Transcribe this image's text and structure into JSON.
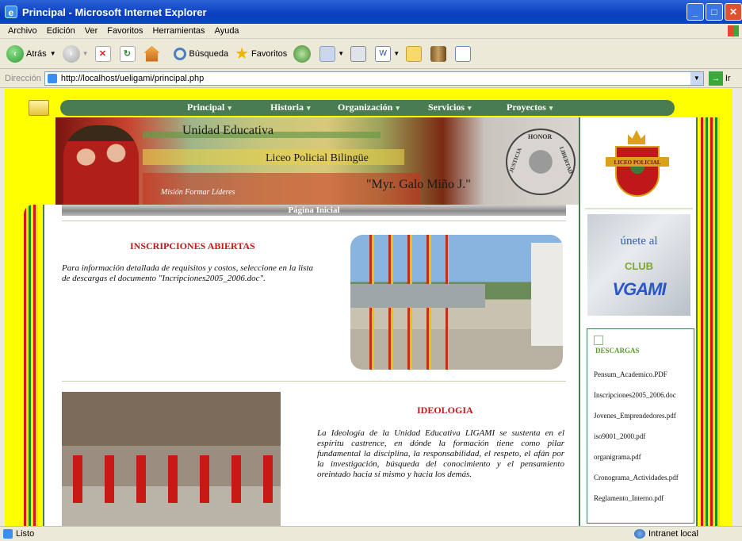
{
  "window": {
    "title": "Principal - Microsoft Internet Explorer"
  },
  "menu": [
    "Archivo",
    "Edición",
    "Ver",
    "Favoritos",
    "Herramientas",
    "Ayuda"
  ],
  "toolbar": {
    "back": "Atrás",
    "search": "Búsqueda",
    "favorites": "Favoritos"
  },
  "address": {
    "label": "Dirección",
    "url": "http://localhost/ueligami/principal.php",
    "go": "Ir"
  },
  "nav": [
    {
      "label": "Principal"
    },
    {
      "label": "Historia"
    },
    {
      "label": "Organización"
    },
    {
      "label": "Servicios"
    },
    {
      "label": "Proyectos"
    }
  ],
  "banner": {
    "line1": "Unidad Educativa",
    "line2": "Liceo Policial Bilingüe",
    "line3": "\"Myr. Galo Miño J.\"",
    "motto": "Misión Formar Líderes",
    "seal_top": "HONOR",
    "seal_left": "JUSTICIA",
    "seal_right": "LIBERTAD"
  },
  "logo": {
    "text": "LICEO POLICIAL"
  },
  "club": {
    "line1": "únete al",
    "line2": "CLUB",
    "line3": "VGAMI"
  },
  "page_header": "Página Inicial",
  "inscripciones": {
    "title": "INSCRIPCIONES ABIERTAS",
    "text": "Para información detallada de requisitos y costos, seleccione en la lista de descargas el documento \"Incripciones2005_2006.doc\"."
  },
  "ideologia": {
    "title": "IDEOLOGIA",
    "text": "La Ideología de la Unidad Educativa LIGAMI se sustenta en el espíritu castrence, en dónde la formación tiene como pilar fundamental la disciplina, la responsabilidad, el respeto, el afán por la investigación, búsqueda del conocimiento y el pensamiento oreintado hacia sí mismo y hacia los demás."
  },
  "descargas": {
    "title": "DESCARGAS",
    "items": [
      "Pensum_Academico.PDF",
      "Inscripciones2005_2006.doc",
      "Jovenes_Emprendedores.pdf",
      "iso9001_2000.pdf",
      "organigrama.pdf",
      "Cronograma_Actividades.pdf",
      "Reglamento_Interno.pdf"
    ]
  },
  "status": {
    "left": "Listo",
    "zone": "Intranet local"
  }
}
